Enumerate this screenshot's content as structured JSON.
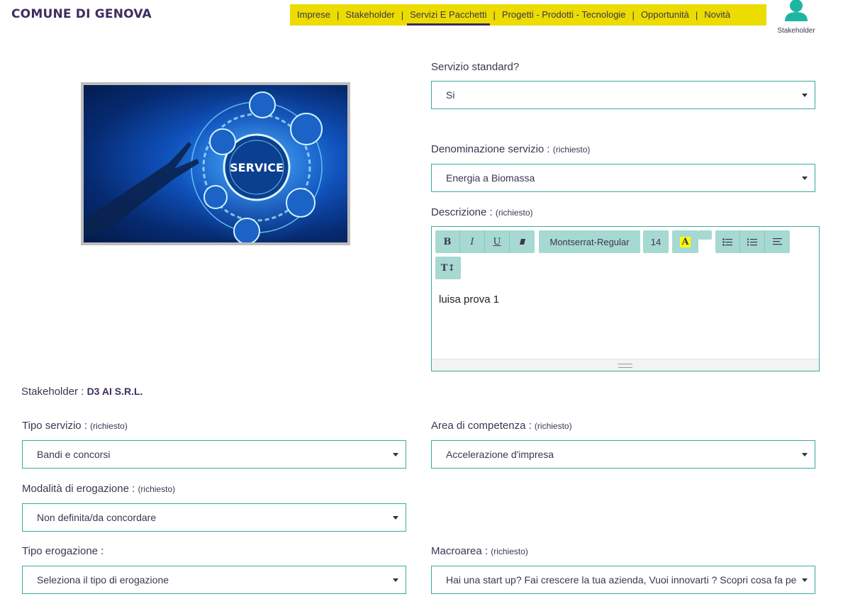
{
  "header": {
    "brand": "COMUNE DI GENOVA",
    "nav": [
      {
        "label": "Imprese"
      },
      {
        "label": "Stakeholder"
      },
      {
        "label": "Servizi E Pacchetti",
        "active": true
      },
      {
        "label": "Progetti - Prodotti - Tecnologie"
      },
      {
        "label": "Opportunità"
      },
      {
        "label": "Novità"
      }
    ],
    "user_label": "Stakeholder",
    "user_icon": "user-icon"
  },
  "hero": {
    "image_text": "SERVICE"
  },
  "form": {
    "standard": {
      "label": "Servizio standard?",
      "value": "Si"
    },
    "denominazione": {
      "label": "Denominazione servizio :",
      "req": "(richiesto)",
      "value": "Energia a Biomassa"
    },
    "descrizione": {
      "label": "Descrizione :",
      "req": "(richiesto)",
      "toolbar": {
        "bold": "B",
        "italic": "I",
        "underline": "U",
        "font": "Montserrat-Regular",
        "size": "14",
        "color_letter": "A",
        "para": "T↕"
      },
      "content": "luisa prova 1"
    },
    "stakeholder": {
      "label": "Stakeholder :",
      "value": "D3 AI S.R.L."
    },
    "tipo_servizio": {
      "label": "Tipo servizio :",
      "req": "(richiesto)",
      "value": "Bandi e concorsi"
    },
    "area": {
      "label": "Area di competenza :",
      "req": "(richiesto)",
      "value": "Accelerazione d'impresa"
    },
    "modalita": {
      "label": "Modalità di erogazione :",
      "req": "(richiesto)",
      "value": "Non definita/da concordare"
    },
    "tipo_erogazione": {
      "label": "Tipo erogazione :",
      "value": "Seleziona il tipo di erogazione"
    },
    "macroarea": {
      "label": "Macroarea :",
      "req": "(richiesto)",
      "value": "Hai una start up? Fai crescere la tua azienda, Vuoi innovarti ? Scopri cosa fa per te"
    }
  },
  "colors": {
    "accent": "#ecdc00",
    "brand": "#3f2d5f",
    "teal": "#3aa99f",
    "toolbar": "#a6d9d1"
  }
}
